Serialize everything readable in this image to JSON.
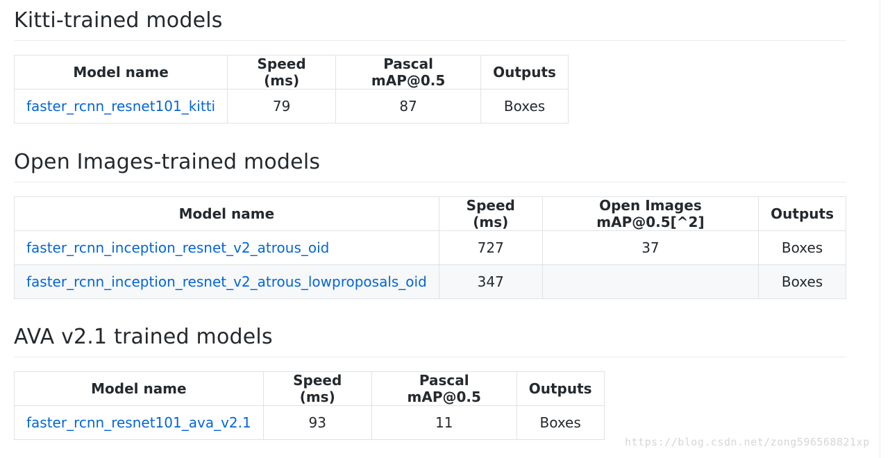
{
  "sections": [
    {
      "title": "Kitti-trained models",
      "headers": [
        "Model name",
        "Speed (ms)",
        "Pascal mAP@0.5",
        "Outputs"
      ],
      "rows": [
        [
          "faster_rcnn_resnet101_kitti",
          "79",
          "87",
          "Boxes"
        ]
      ]
    },
    {
      "title": "Open Images-trained models",
      "headers": [
        "Model name",
        "Speed (ms)",
        "Open Images mAP@0.5[^2]",
        "Outputs"
      ],
      "rows": [
        [
          "faster_rcnn_inception_resnet_v2_atrous_oid",
          "727",
          "37",
          "Boxes"
        ],
        [
          "faster_rcnn_inception_resnet_v2_atrous_lowproposals_oid",
          "347",
          "",
          "Boxes"
        ]
      ]
    },
    {
      "title": "AVA v2.1 trained models",
      "headers": [
        "Model name",
        "Speed (ms)",
        "Pascal mAP@0.5",
        "Outputs"
      ],
      "rows": [
        [
          "faster_rcnn_resnet101_ava_v2.1",
          "93",
          "11",
          "Boxes"
        ]
      ]
    }
  ],
  "watermark": "https://blog.csdn.net/zong596568821xp",
  "colors": {
    "link": "#0366d6",
    "border": "#dfe2e5",
    "alt_row": "#f6f8fa",
    "text": "#24292e"
  }
}
